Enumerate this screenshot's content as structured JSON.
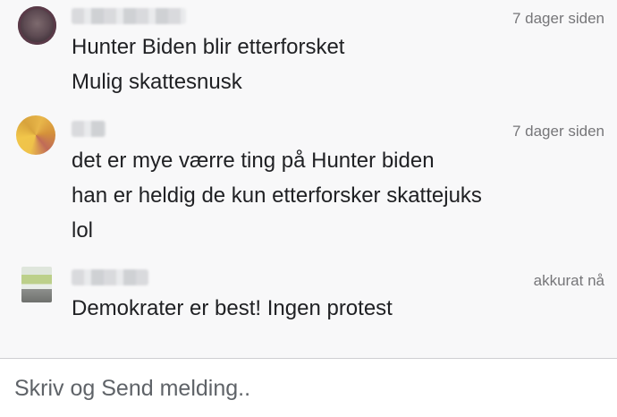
{
  "messages": [
    {
      "avatar_icon": "profile-avatar",
      "time": "7 dager siden",
      "lines": [
        "Hunter Biden blir etterforsket",
        "Mulig skattesnusk"
      ]
    },
    {
      "avatar_icon": "profile-avatar",
      "time": "7 dager siden",
      "lines": [
        "det er mye værre ting på Hunter biden",
        "han er heldig de kun etterforsker skattejuks",
        "lol"
      ]
    },
    {
      "avatar_icon": "profile-avatar",
      "time": "akkurat nå",
      "lines": [
        "Demokrater er best! Ingen protest"
      ]
    }
  ],
  "composer": {
    "placeholder": "Skriv og Send melding.."
  }
}
